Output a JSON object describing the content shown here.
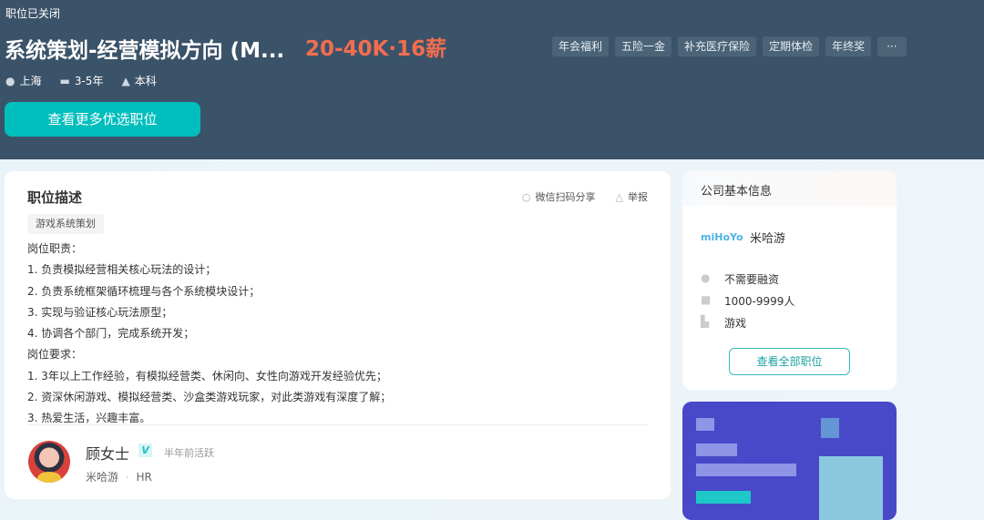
{
  "header": {
    "status": "职位已关闭",
    "title": "系统策划-经营模拟方向 (M...",
    "salary": "20-40K·16薪",
    "benefits": [
      "年会福利",
      "五险一金",
      "补充医疗保险",
      "定期体检",
      "年终奖",
      "···"
    ],
    "location": "上海",
    "experience": "3-5年",
    "education": "本科",
    "more_button": "查看更多优选职位"
  },
  "job": {
    "section_title": "职位描述",
    "share": "微信扫码分享",
    "report": "举报",
    "skill_tag": "游戏系统策划",
    "lines": [
      "岗位职责：",
      "1. 负责模拟经营相关核心玩法的设计；",
      "2. 负责系统框架循环梳理与各个系统模块设计；",
      "3. 实现与验证核心玩法原型；",
      "4. 协调各个部门，完成系统开发；",
      "岗位要求：",
      "1. 3年以上工作经验，有模拟经营类、休闲向、女性向游戏开发经验优先；",
      "2. 资深休闲游戏、模拟经营类、沙盒类游戏玩家，对此类游戏有深度了解；",
      "3. 热爱生活，兴趣丰富。"
    ]
  },
  "recruiter": {
    "name": "顾女士",
    "badge": "V",
    "active": "半年前活跃",
    "company": "米哈游",
    "sep": "·",
    "role": "HR"
  },
  "company": {
    "section_title": "公司基本信息",
    "logo_text": "miHoYo",
    "name": "米哈游",
    "financing": "不需要融资",
    "size": "1000-9999人",
    "industry": "游戏",
    "all_jobs_button": "查看全部职位"
  },
  "colors": {
    "header_bg": "#3b5369",
    "accent": "#00bebd",
    "salary": "#f26d4f"
  }
}
